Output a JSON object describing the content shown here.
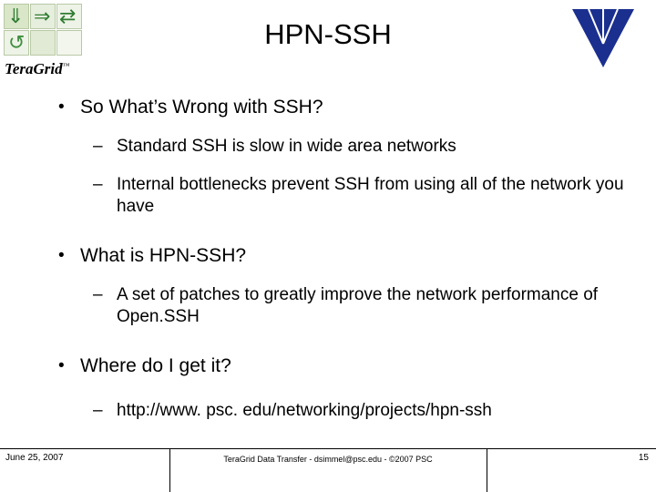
{
  "slide": {
    "title": "HPN-SSH",
    "logo": {
      "wordmark": "TeraGrid",
      "trademark": "™",
      "arrow_glyphs": [
        "⇓",
        "⇒",
        "⇄",
        "↺"
      ]
    },
    "content": [
      {
        "level": 1,
        "bullet": "•",
        "text": "So What’s Wrong with SSH?"
      },
      {
        "level": 2,
        "bullet": "–",
        "text": "Standard SSH is slow in wide area networks"
      },
      {
        "level": 2,
        "bullet": "–",
        "text": "Internal bottlenecks prevent SSH from using all of the network you have"
      },
      {
        "level": 1,
        "bullet": "•",
        "text": "What is HPN-SSH?"
      },
      {
        "level": 2,
        "bullet": "–",
        "text": "A set of patches to greatly improve the network performance of Open.SSH"
      },
      {
        "level": 1,
        "bullet": "•",
        "text": "Where do I get it?"
      },
      {
        "level": 2,
        "bullet": "–",
        "text": "http://www. psc. edu/networking/projects/hpn-ssh"
      }
    ],
    "footer": {
      "date": "June 25, 2007",
      "center": "TeraGrid Data Transfer - dsimmel@psc.edu - ©2007 PSC",
      "page": "15"
    },
    "colors": {
      "triangle": "#1b2f8f",
      "logo_green": "#2f7d32",
      "text": "#000000",
      "background": "#ffffff"
    }
  }
}
